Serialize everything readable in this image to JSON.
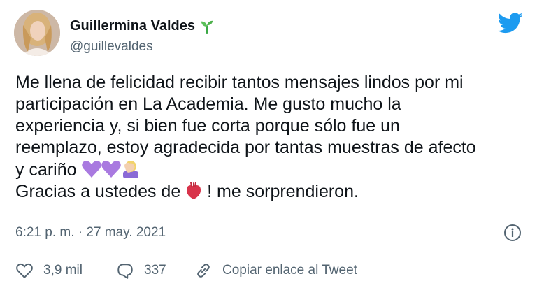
{
  "user": {
    "name": "Guillermina Valdes",
    "handle": "@guillevaldes"
  },
  "tweet": {
    "lines": [
      "Me llena de felicidad recibir tantos mensajes lindos por mi",
      "participación en La Academia. Me gusto mucho  la",
      "experiencia y, si bien fue corta porque sólo fue un",
      "reemplazo, estoy agradecida por tantas muestras de afecto",
      "y cariño",
      "Gracias a ustedes de",
      "! me sorprendieron."
    ],
    "timestamp": "6:21 p. m. · 27 may. 2021"
  },
  "actions": {
    "likes": "3,9 mil",
    "replies": "337",
    "copy_label": "Copiar enlace al Tweet"
  },
  "colors": {
    "twitter_blue": "#1d9bf0",
    "text": "#0f1419",
    "secondary": "#536471",
    "divider": "#cfd9de"
  },
  "icons": [
    "sprout-icon",
    "twitter-logo-icon",
    "info-icon",
    "heart-icon",
    "reply-icon",
    "link-icon",
    "purple-heart-emoji",
    "person-facepalm-emoji",
    "anatomical-heart-emoji"
  ]
}
